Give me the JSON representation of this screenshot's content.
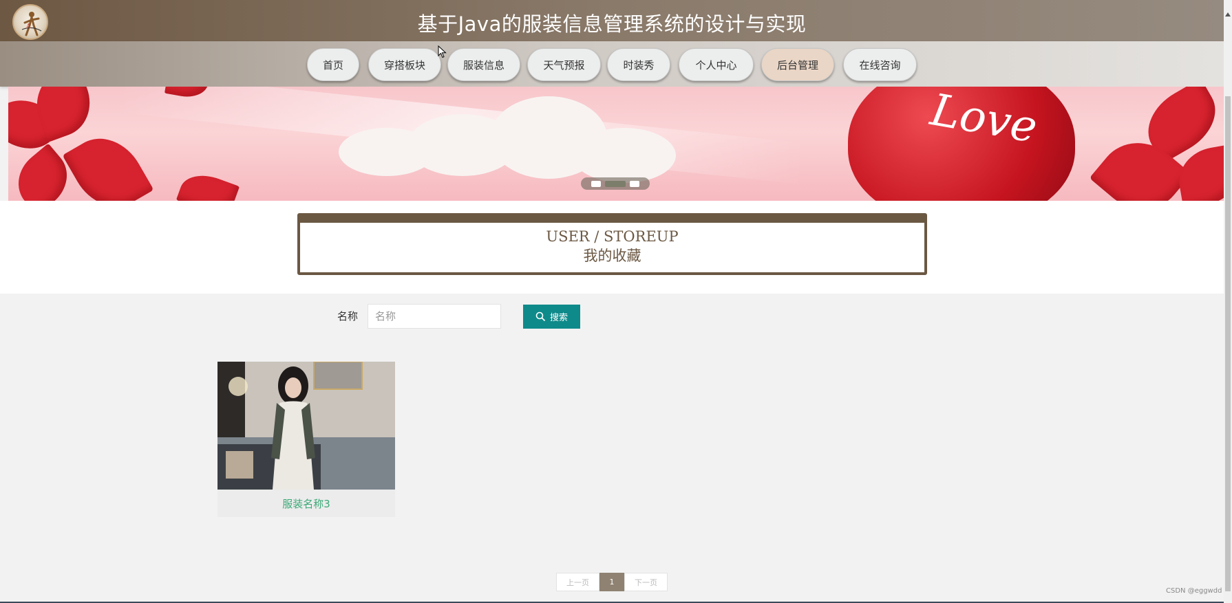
{
  "header": {
    "title": "基于Java的服装信息管理系统的设计与实现",
    "logo": "mannequin-logo",
    "colors": {
      "header_start": "#6d5843",
      "header_end": "#968b80"
    }
  },
  "nav": {
    "items": [
      {
        "label": "首页",
        "active": false
      },
      {
        "label": "穿搭板块",
        "active": false
      },
      {
        "label": "服装信息",
        "active": false
      },
      {
        "label": "天气预报",
        "active": false
      },
      {
        "label": "时装秀",
        "active": false
      },
      {
        "label": "个人中心",
        "active": false
      },
      {
        "label": "后台管理",
        "active": true
      },
      {
        "label": "在线咨询",
        "active": false
      }
    ]
  },
  "banner": {
    "overlay_text": "Love",
    "slide_count": 3,
    "active_slide": 2
  },
  "section": {
    "title_en": "USER / STOREUP",
    "title_cn": "我的收藏",
    "accent": "#6b5843"
  },
  "search": {
    "label": "名称",
    "placeholder": "名称",
    "value": "",
    "button_label": "搜索",
    "button_icon": "search-icon",
    "button_color": "#0f8a8a"
  },
  "items": [
    {
      "name": "服装名称3",
      "name_color": "#3aa876"
    }
  ],
  "pagination": {
    "prev_label": "上一页",
    "current_page": "1",
    "next_label": "下一页"
  },
  "watermark": "CSDN @eggwdd"
}
